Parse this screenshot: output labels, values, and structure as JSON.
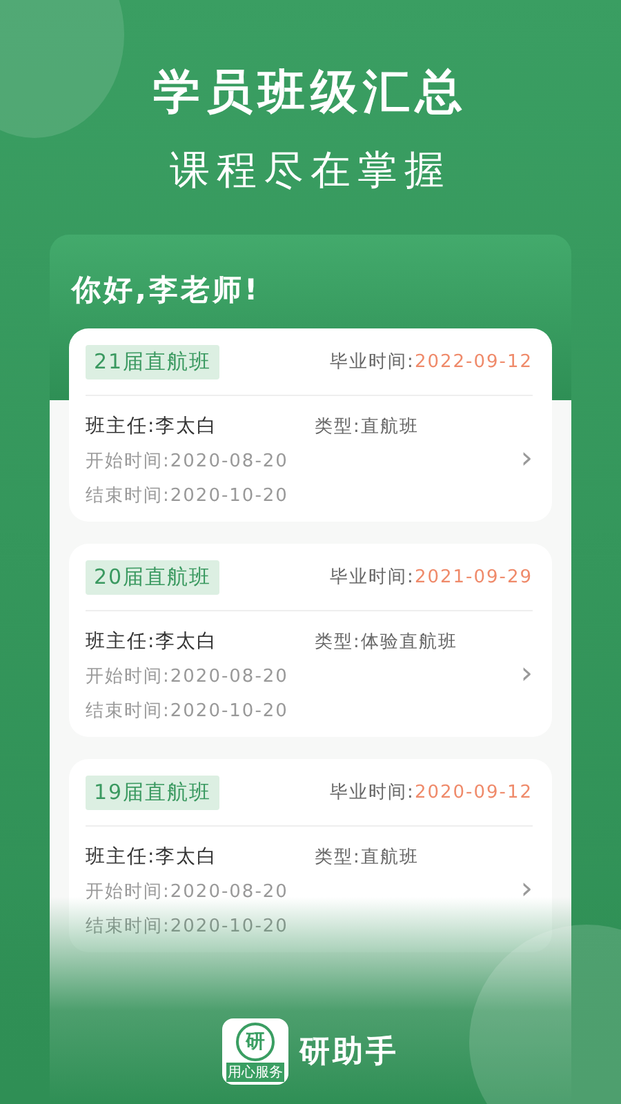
{
  "header": {
    "title": "学员班级汇总",
    "subtitle": "课程尽在掌握"
  },
  "greeting": "你好,李老师!",
  "classes": [
    {
      "name": "21届直航班",
      "graduation_label": "毕业时间:",
      "graduation_date": "2022-09-12",
      "teacher": "班主任:李太白",
      "type": "类型:直航班",
      "start": "开始时间:2020-08-20",
      "end": "结束时间:2020-10-20",
      "chevron": "›"
    },
    {
      "name": "20届直航班",
      "graduation_label": "毕业时间:",
      "graduation_date": "2021-09-29",
      "teacher": "班主任:李太白",
      "type": "类型:体验直航班",
      "start": "开始时间:2020-08-20",
      "end": "结束时间:2020-10-20",
      "chevron": "›"
    },
    {
      "name": "19届直航班",
      "graduation_label": "毕业时间:",
      "graduation_date": "2020-09-12",
      "teacher": "班主任:李太白",
      "type": "类型:直航班",
      "start": "开始时间:2020-08-20",
      "end": "结束时间:2020-10-20",
      "chevron": "›"
    }
  ],
  "brand": {
    "logo_char": "研",
    "logo_tagline": "用心服务",
    "name": "研助手"
  }
}
